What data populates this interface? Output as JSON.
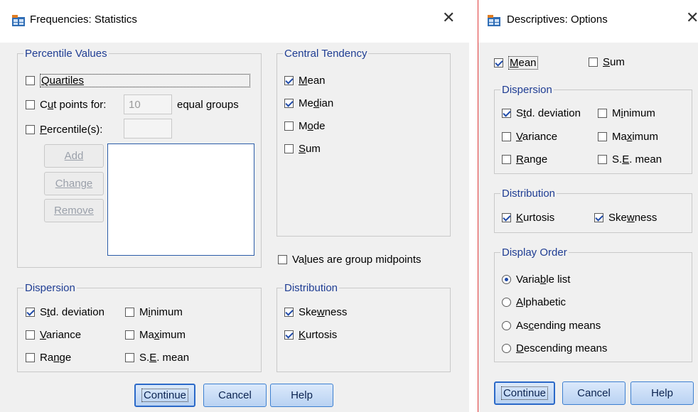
{
  "freq": {
    "title": "Frequencies: Statistics",
    "percentile_group": "Percentile Values",
    "quartiles": "Quartiles",
    "cut_points_pre": "Cut points for: ",
    "cut_points_value": "10",
    "equal_groups": "equal groups",
    "percentiles_pre": "",
    "percentiles_u": "P",
    "percentiles_post": "ercentile(s):",
    "cut_u": "u",
    "cut_c": "C",
    "cut_rest": "t points for:",
    "add": "Add",
    "change": "Change",
    "remove": "Remove",
    "central_group": "Central Tendency",
    "mean_u": "M",
    "mean_rest": "ean",
    "median_pre": "Me",
    "median_u": "d",
    "median_post": "ian",
    "mode_pre": "M",
    "mode_u": "o",
    "mode_post": "de",
    "sum_u": "S",
    "sum_rest": "um",
    "group_midpoints_pre": "Va",
    "group_midpoints_u": "l",
    "group_midpoints_post": "ues are group midpoints",
    "dispersion_group": "Dispersion",
    "std_pre": "S",
    "std_u": "t",
    "std_post": "d. deviation",
    "min_pre": "M",
    "min_u": "i",
    "min_post": "nimum",
    "var_u": "V",
    "var_post": "ariance",
    "max_pre": "Ma",
    "max_u": "x",
    "max_post": "imum",
    "range_pre": "Ra",
    "range_u": "n",
    "range_post": "ge",
    "se_pre": "S.",
    "se_u": "E",
    "se_post": ". mean",
    "distribution_group": "Distribution",
    "skew_pre": "Ske",
    "skew_u": "w",
    "skew_post": "ness",
    "kurt_u": "K",
    "kurt_post": "urtosis",
    "continue": "Continue",
    "cancel": "Cancel",
    "help": "Help",
    "checked": {
      "quartiles": false,
      "cut_points": false,
      "percentiles": false,
      "mean": true,
      "median": true,
      "mode": false,
      "sum": false,
      "group_midpoints": false,
      "std_deviation": true,
      "minimum": false,
      "variance": false,
      "maximum": false,
      "range": false,
      "se_mean": false,
      "skewness": true,
      "kurtosis": true
    }
  },
  "desc": {
    "title": "Descriptives: Options",
    "mean_u": "M",
    "mean_rest": "ean",
    "sum_u": "S",
    "sum_rest": "um",
    "dispersion_group": "Dispersion",
    "std_pre": "S",
    "std_u": "t",
    "std_post": "d. deviation",
    "min_pre": "M",
    "min_u": "i",
    "min_post": "nimum",
    "var_u": "V",
    "var_post": "ariance",
    "max_pre": "Ma",
    "max_u": "x",
    "max_post": "imum",
    "range_u": "R",
    "range_post": "ange",
    "se_pre": "S.",
    "se_u": "E",
    "se_post": ". mean",
    "distribution_group": "Distribution",
    "kurt_u": "K",
    "kurt_post": "urtosis",
    "skew_pre": "Ske",
    "skew_u": "w",
    "skew_post": "ness",
    "order_group": "Display Order",
    "varlist_pre": "Varia",
    "varlist_u": "b",
    "varlist_post": "le list",
    "alpha_u": "A",
    "alpha_post": "lphabetic",
    "asc_pre": "As",
    "asc_u": "c",
    "asc_post": "ending means",
    "desc_u": "D",
    "desc_post": "escending means",
    "continue": "Continue",
    "cancel": "Cancel",
    "help": "Help",
    "checked": {
      "mean": true,
      "sum": false,
      "std_deviation": true,
      "minimum": false,
      "variance": false,
      "maximum": false,
      "range": false,
      "se_mean": false,
      "kurtosis": true,
      "skewness": true
    },
    "selected_order": "Variable list"
  },
  "colors": {
    "legend": "#1f3d93",
    "button_border": "#3c7fd0",
    "check": "#1f4aa8",
    "dialog_border": "#e03c3c"
  },
  "icons": {
    "app": "spss-table-icon",
    "close": "close-icon"
  }
}
